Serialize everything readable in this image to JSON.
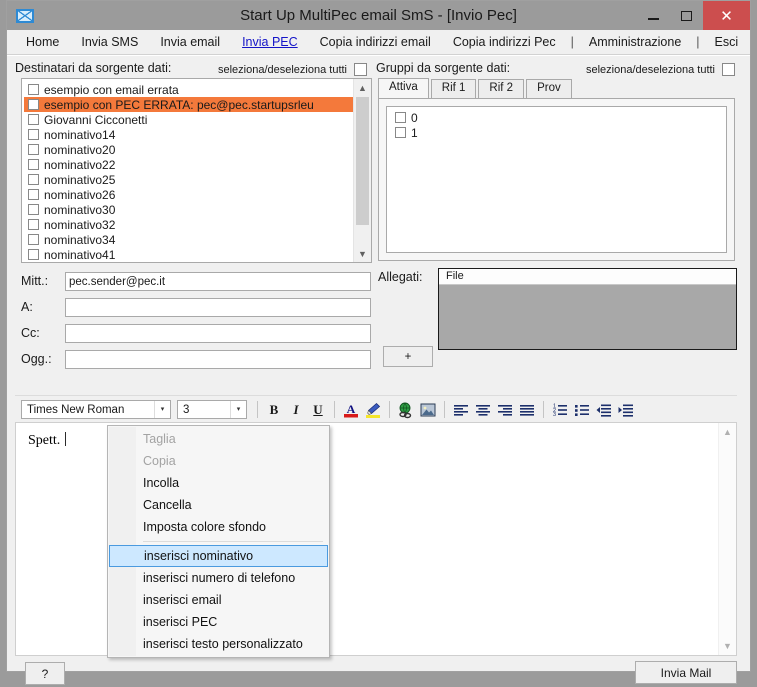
{
  "window": {
    "title": "Start Up MultiPec email SmS - [Invio Pec]",
    "app_icon": "envelope-icon",
    "minimize": "–",
    "maximize": "□",
    "close": "✕"
  },
  "menubar": {
    "items": [
      {
        "label": "Home",
        "active": false
      },
      {
        "label": "Invia SMS",
        "active": false
      },
      {
        "label": "Invia email",
        "active": false
      },
      {
        "label": "Invia PEC",
        "active": true
      },
      {
        "label": "Copia indirizzi email",
        "active": false
      },
      {
        "label": "Copia indirizzi Pec",
        "active": false
      },
      {
        "label": "|",
        "active": false
      },
      {
        "label": "Amministrazione",
        "active": false
      },
      {
        "label": "|",
        "active": false
      },
      {
        "label": "Esci",
        "active": false
      }
    ]
  },
  "recipients": {
    "title": "Destinatari da sorgente dati:",
    "select_all_label": "seleziona/deseleziona tutti",
    "items": [
      {
        "label": "esempio con email errata",
        "selected": false
      },
      {
        "label": "esempio con PEC ERRATA: pec@pec.startupsrleu",
        "selected": true
      },
      {
        "label": "Giovanni Cicconetti",
        "selected": false
      },
      {
        "label": "nominativo14",
        "selected": false
      },
      {
        "label": "nominativo20",
        "selected": false
      },
      {
        "label": "nominativo22",
        "selected": false
      },
      {
        "label": "nominativo25",
        "selected": false
      },
      {
        "label": "nominativo26",
        "selected": false
      },
      {
        "label": "nominativo30",
        "selected": false
      },
      {
        "label": "nominativo32",
        "selected": false
      },
      {
        "label": "nominativo34",
        "selected": false
      },
      {
        "label": "nominativo41",
        "selected": false
      }
    ],
    "highlight_color": "#f4793b"
  },
  "groups": {
    "title": "Gruppi da sorgente dati:",
    "select_all_label": "seleziona/deseleziona tutti",
    "tabs": [
      {
        "label": "Attiva",
        "active": true
      },
      {
        "label": "Rif 1",
        "active": false
      },
      {
        "label": "Rif 2",
        "active": false
      },
      {
        "label": "Prov",
        "active": false
      }
    ],
    "items": [
      {
        "label": "0",
        "selected": false
      },
      {
        "label": "1",
        "selected": false
      }
    ]
  },
  "form": {
    "fields": [
      {
        "label": "Mitt.:",
        "value": "pec.sender@pec.it"
      },
      {
        "label": "A:",
        "value": ""
      },
      {
        "label": "Cc:",
        "value": ""
      },
      {
        "label": "Ogg.:",
        "value": ""
      }
    ],
    "add_attachment_button": "+"
  },
  "attachments": {
    "label": "Allegati:",
    "column_header": "File",
    "rows": []
  },
  "toolbar": {
    "font_family": "Times New Roman",
    "font_size": "3",
    "dropdown_arrow": "▾",
    "buttons": [
      {
        "name": "bold-button",
        "glyph": "B"
      },
      {
        "name": "italic-button",
        "glyph": "I"
      },
      {
        "name": "underline-button",
        "glyph": "U"
      },
      {
        "name": "font-color-button",
        "glyph": "A"
      },
      {
        "name": "highlight-color-button",
        "glyph": "✎"
      },
      {
        "name": "insert-link-button",
        "glyph": "⊕"
      },
      {
        "name": "insert-image-button",
        "glyph": "⌧"
      },
      {
        "name": "align-left-button",
        "glyph": ""
      },
      {
        "name": "align-center-button",
        "glyph": ""
      },
      {
        "name": "align-right-button",
        "glyph": ""
      },
      {
        "name": "align-justify-button",
        "glyph": ""
      },
      {
        "name": "numbered-list-button",
        "glyph": ""
      },
      {
        "name": "bullet-list-button",
        "glyph": ""
      },
      {
        "name": "outdent-button",
        "glyph": ""
      },
      {
        "name": "indent-button",
        "glyph": ""
      }
    ]
  },
  "editor": {
    "body_text": "Spett."
  },
  "context_menu": {
    "items": [
      {
        "label": "Taglia",
        "disabled": true,
        "highlighted": false,
        "separator_after": false
      },
      {
        "label": "Copia",
        "disabled": true,
        "highlighted": false,
        "separator_after": false
      },
      {
        "label": "Incolla",
        "disabled": false,
        "highlighted": false,
        "separator_after": false
      },
      {
        "label": "Cancella",
        "disabled": false,
        "highlighted": false,
        "separator_after": false
      },
      {
        "label": "Imposta colore sfondo",
        "disabled": false,
        "highlighted": false,
        "separator_after": true
      },
      {
        "label": "inserisci nominativo",
        "disabled": false,
        "highlighted": true,
        "separator_after": false
      },
      {
        "label": "inserisci numero di telefono",
        "disabled": false,
        "highlighted": false,
        "separator_after": false
      },
      {
        "label": "inserisci email",
        "disabled": false,
        "highlighted": false,
        "separator_after": false
      },
      {
        "label": "inserisci PEC",
        "disabled": false,
        "highlighted": false,
        "separator_after": false
      },
      {
        "label": "inserisci testo personalizzato",
        "disabled": false,
        "highlighted": false,
        "separator_after": false
      }
    ],
    "highlight_color": "#cde8ff"
  },
  "footer": {
    "help_label": "?",
    "send_label": "Invia Mail"
  }
}
